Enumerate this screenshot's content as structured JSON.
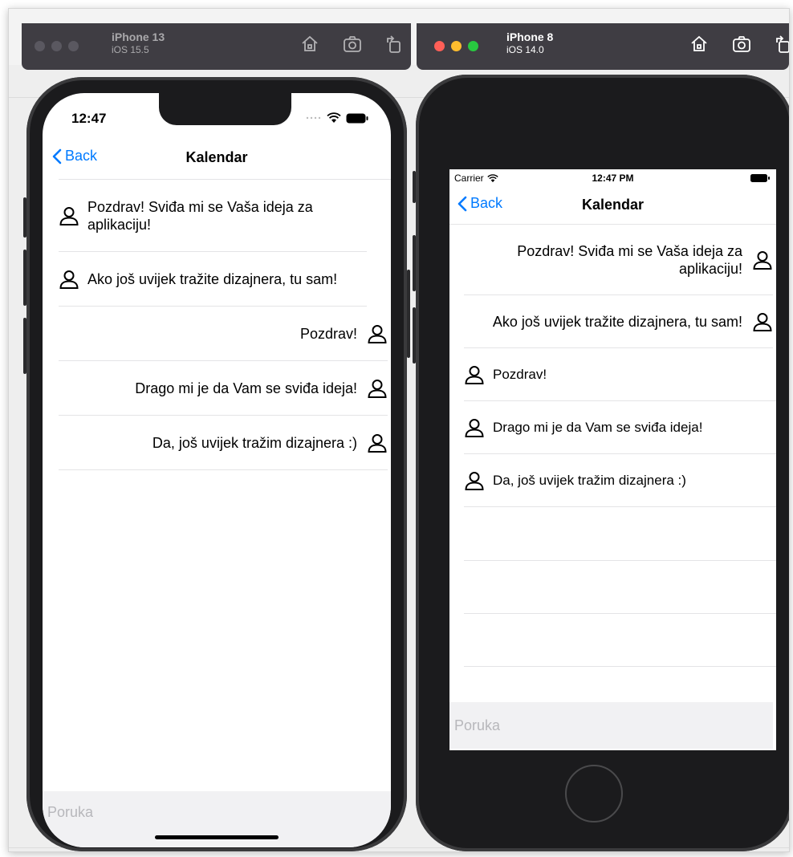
{
  "simulators": [
    {
      "device": "iPhone 13",
      "os": "iOS 15.5",
      "active": false
    },
    {
      "device": "iPhone 8",
      "os": "iOS 14.0",
      "active": true
    }
  ],
  "toolbar_icons": [
    "home-icon",
    "screenshot-icon",
    "rotate-icon"
  ],
  "colors": {
    "ios_blue": "#007aff",
    "traffic_red": "#ff5f57",
    "traffic_yellow": "#febc2e",
    "traffic_green": "#28c840",
    "inactive_light": "#5a5860"
  },
  "iphone13": {
    "status": {
      "time": "12:47"
    },
    "nav": {
      "back": "Back",
      "title": "Kalendar"
    },
    "messages": [
      {
        "text": "Pozdrav! Sviđa mi se Vaša ideja za aplikaciju!",
        "side": "left"
      },
      {
        "text": "Ako još uvijek tražite dizajnera, tu sam!",
        "side": "left"
      },
      {
        "text": "Pozdrav!",
        "side": "right"
      },
      {
        "text": "Drago mi je da Vam se sviđa ideja!",
        "side": "right"
      },
      {
        "text": "Da, još uvijek tražim dizajnera :)",
        "side": "right"
      }
    ],
    "input_placeholder": "Poruka"
  },
  "iphone8": {
    "status": {
      "carrier": "Carrier",
      "time": "12:47 PM"
    },
    "nav": {
      "back": "Back",
      "title": "Kalendar"
    },
    "messages": [
      {
        "text": "Pozdrav! Sviđa mi se Vaša ideja za aplikaciju!",
        "side": "right"
      },
      {
        "text": "Ako još uvijek tražite dizajnera, tu sam!",
        "side": "right"
      },
      {
        "text": "Pozdrav!",
        "side": "left"
      },
      {
        "text": "Drago mi je da Vam se sviđa ideja!",
        "side": "left"
      },
      {
        "text": "Da, još uvijek tražim dizajnera :)",
        "side": "left"
      }
    ],
    "input_placeholder": "Poruka"
  }
}
